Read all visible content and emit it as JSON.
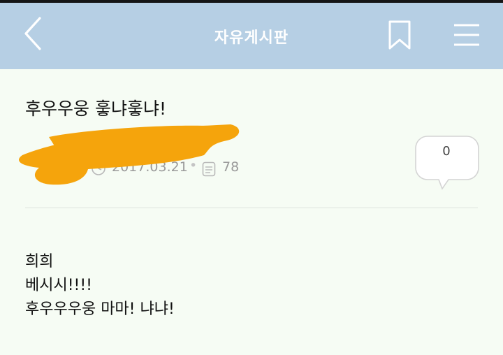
{
  "header": {
    "title": "자유게시판",
    "background": "#b6cfe4"
  },
  "post": {
    "title": "후우우웅 훟냐훟냐!",
    "date": "2017.03.21",
    "separator": "•",
    "views": "78",
    "comment_count": "0",
    "body_lines": [
      "희희",
      "베시시!!!!",
      "후우우우웅 마마! 냐냐!"
    ]
  },
  "icons": {
    "back": "chevron-left-icon",
    "bookmark": "bookmark-icon",
    "menu": "hamburger-menu-icon",
    "date": "clock-icon",
    "views": "document-icon",
    "comment": "speech-bubble-icon"
  },
  "colors": {
    "redaction": "#f5a40c",
    "background": "#f6fcf4"
  }
}
